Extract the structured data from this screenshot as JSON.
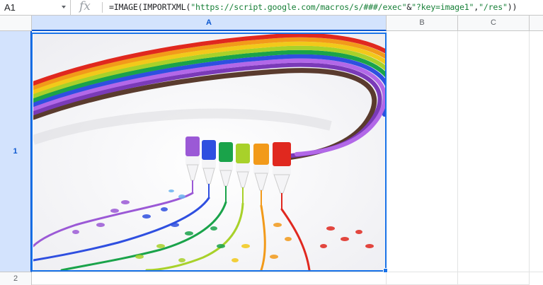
{
  "name_box": {
    "ref": "A1"
  },
  "formula_bar": {
    "fx_label": "fx",
    "prefix": "=IMAGE(IMPORTXML(",
    "str1": "\"https://script.google.com/macros/s/###/exec\"",
    "amp": "&",
    "str2": "\"?key=image1\"",
    "comma": ",",
    "str3": "\"/res\"",
    "suffix": "))"
  },
  "columns": [
    {
      "label": "A"
    },
    {
      "label": "B"
    },
    {
      "label": "C"
    }
  ],
  "rows": [
    {
      "label": "1"
    },
    {
      "label": "2"
    }
  ],
  "selected_cell": "A1",
  "colors": {
    "selection": "#1a73e8",
    "header_bg": "#f8f9fa",
    "header_selected_bg": "#d3e3fd",
    "formula_string": "#188038"
  },
  "image": {
    "description_icon": "rainbow-paint-tubes-image",
    "stripe_colors": [
      "#9b59d6",
      "#2f4fe0",
      "#1aa34a",
      "#a8d12a",
      "#f29a1a",
      "#e0281f"
    ]
  }
}
